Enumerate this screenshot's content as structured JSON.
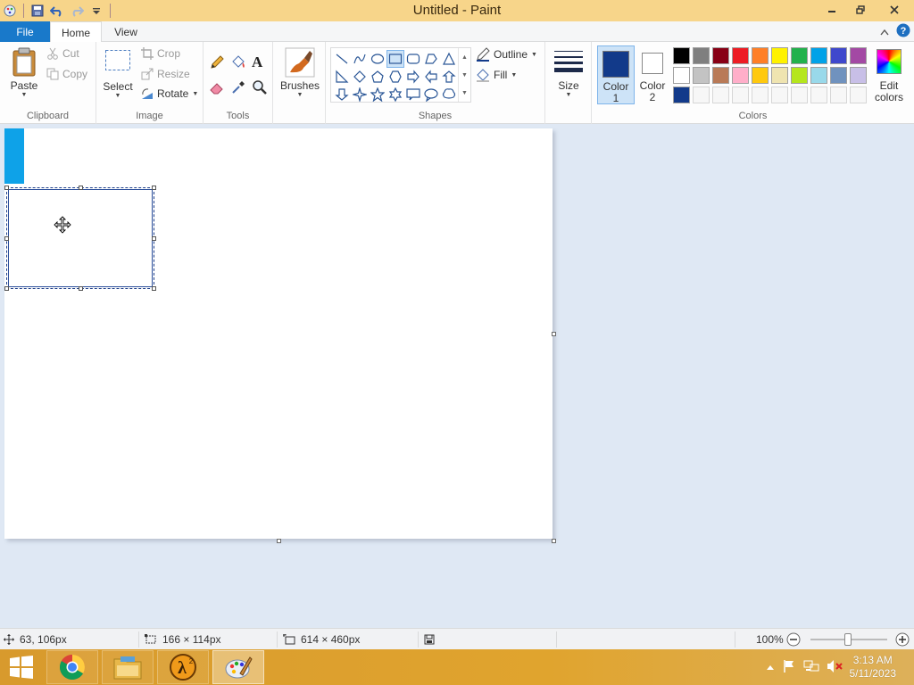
{
  "window": {
    "title": "Untitled - Paint"
  },
  "quick_access": {
    "icons": [
      "paint-menu-icon",
      "save-icon",
      "undo-icon",
      "redo-icon",
      "customize-icon"
    ]
  },
  "tabs": {
    "file": "File",
    "home": "Home",
    "view": "View"
  },
  "clipboard": {
    "paste": "Paste",
    "cut": "Cut",
    "copy": "Copy",
    "label": "Clipboard"
  },
  "image": {
    "select": "Select",
    "crop": "Crop",
    "resize": "Resize",
    "rotate": "Rotate",
    "label": "Image"
  },
  "tools": {
    "label": "Tools"
  },
  "brushes": {
    "label": "Brushes"
  },
  "shapes": {
    "outline": "Outline",
    "fill": "Fill",
    "label": "Shapes"
  },
  "size": {
    "label": "Size"
  },
  "colors": {
    "color1_line1": "Color",
    "color1_line2": "1",
    "color2_line1": "Color",
    "color2_line2": "2",
    "edit_line1": "Edit",
    "edit_line2": "colors",
    "label": "Colors",
    "color1": "#123a8a",
    "color2": "#ffffff",
    "row1": [
      "#000000",
      "#7f7f7f",
      "#880015",
      "#ed1c24",
      "#ff7f27",
      "#fff200",
      "#22b14c",
      "#00a2e8",
      "#3f48cc",
      "#a349a4"
    ],
    "row2": [
      "#ffffff",
      "#c3c3c3",
      "#b97a57",
      "#ffaec9",
      "#ffc90e",
      "#efe4b0",
      "#b5e61d",
      "#99d9ea",
      "#7092be",
      "#c8bfe7"
    ],
    "row3_custom": [
      "#123a8a"
    ]
  },
  "status": {
    "cursor_pos": "63, 106px",
    "selection_size": "166 × 114px",
    "canvas_size": "614 × 460px",
    "zoom": "100%"
  },
  "taskbar": {
    "apps": [
      "chrome",
      "file-explorer",
      "half-life-2",
      "paint"
    ],
    "time": "3:13 AM",
    "date": "5/11/2023"
  }
}
